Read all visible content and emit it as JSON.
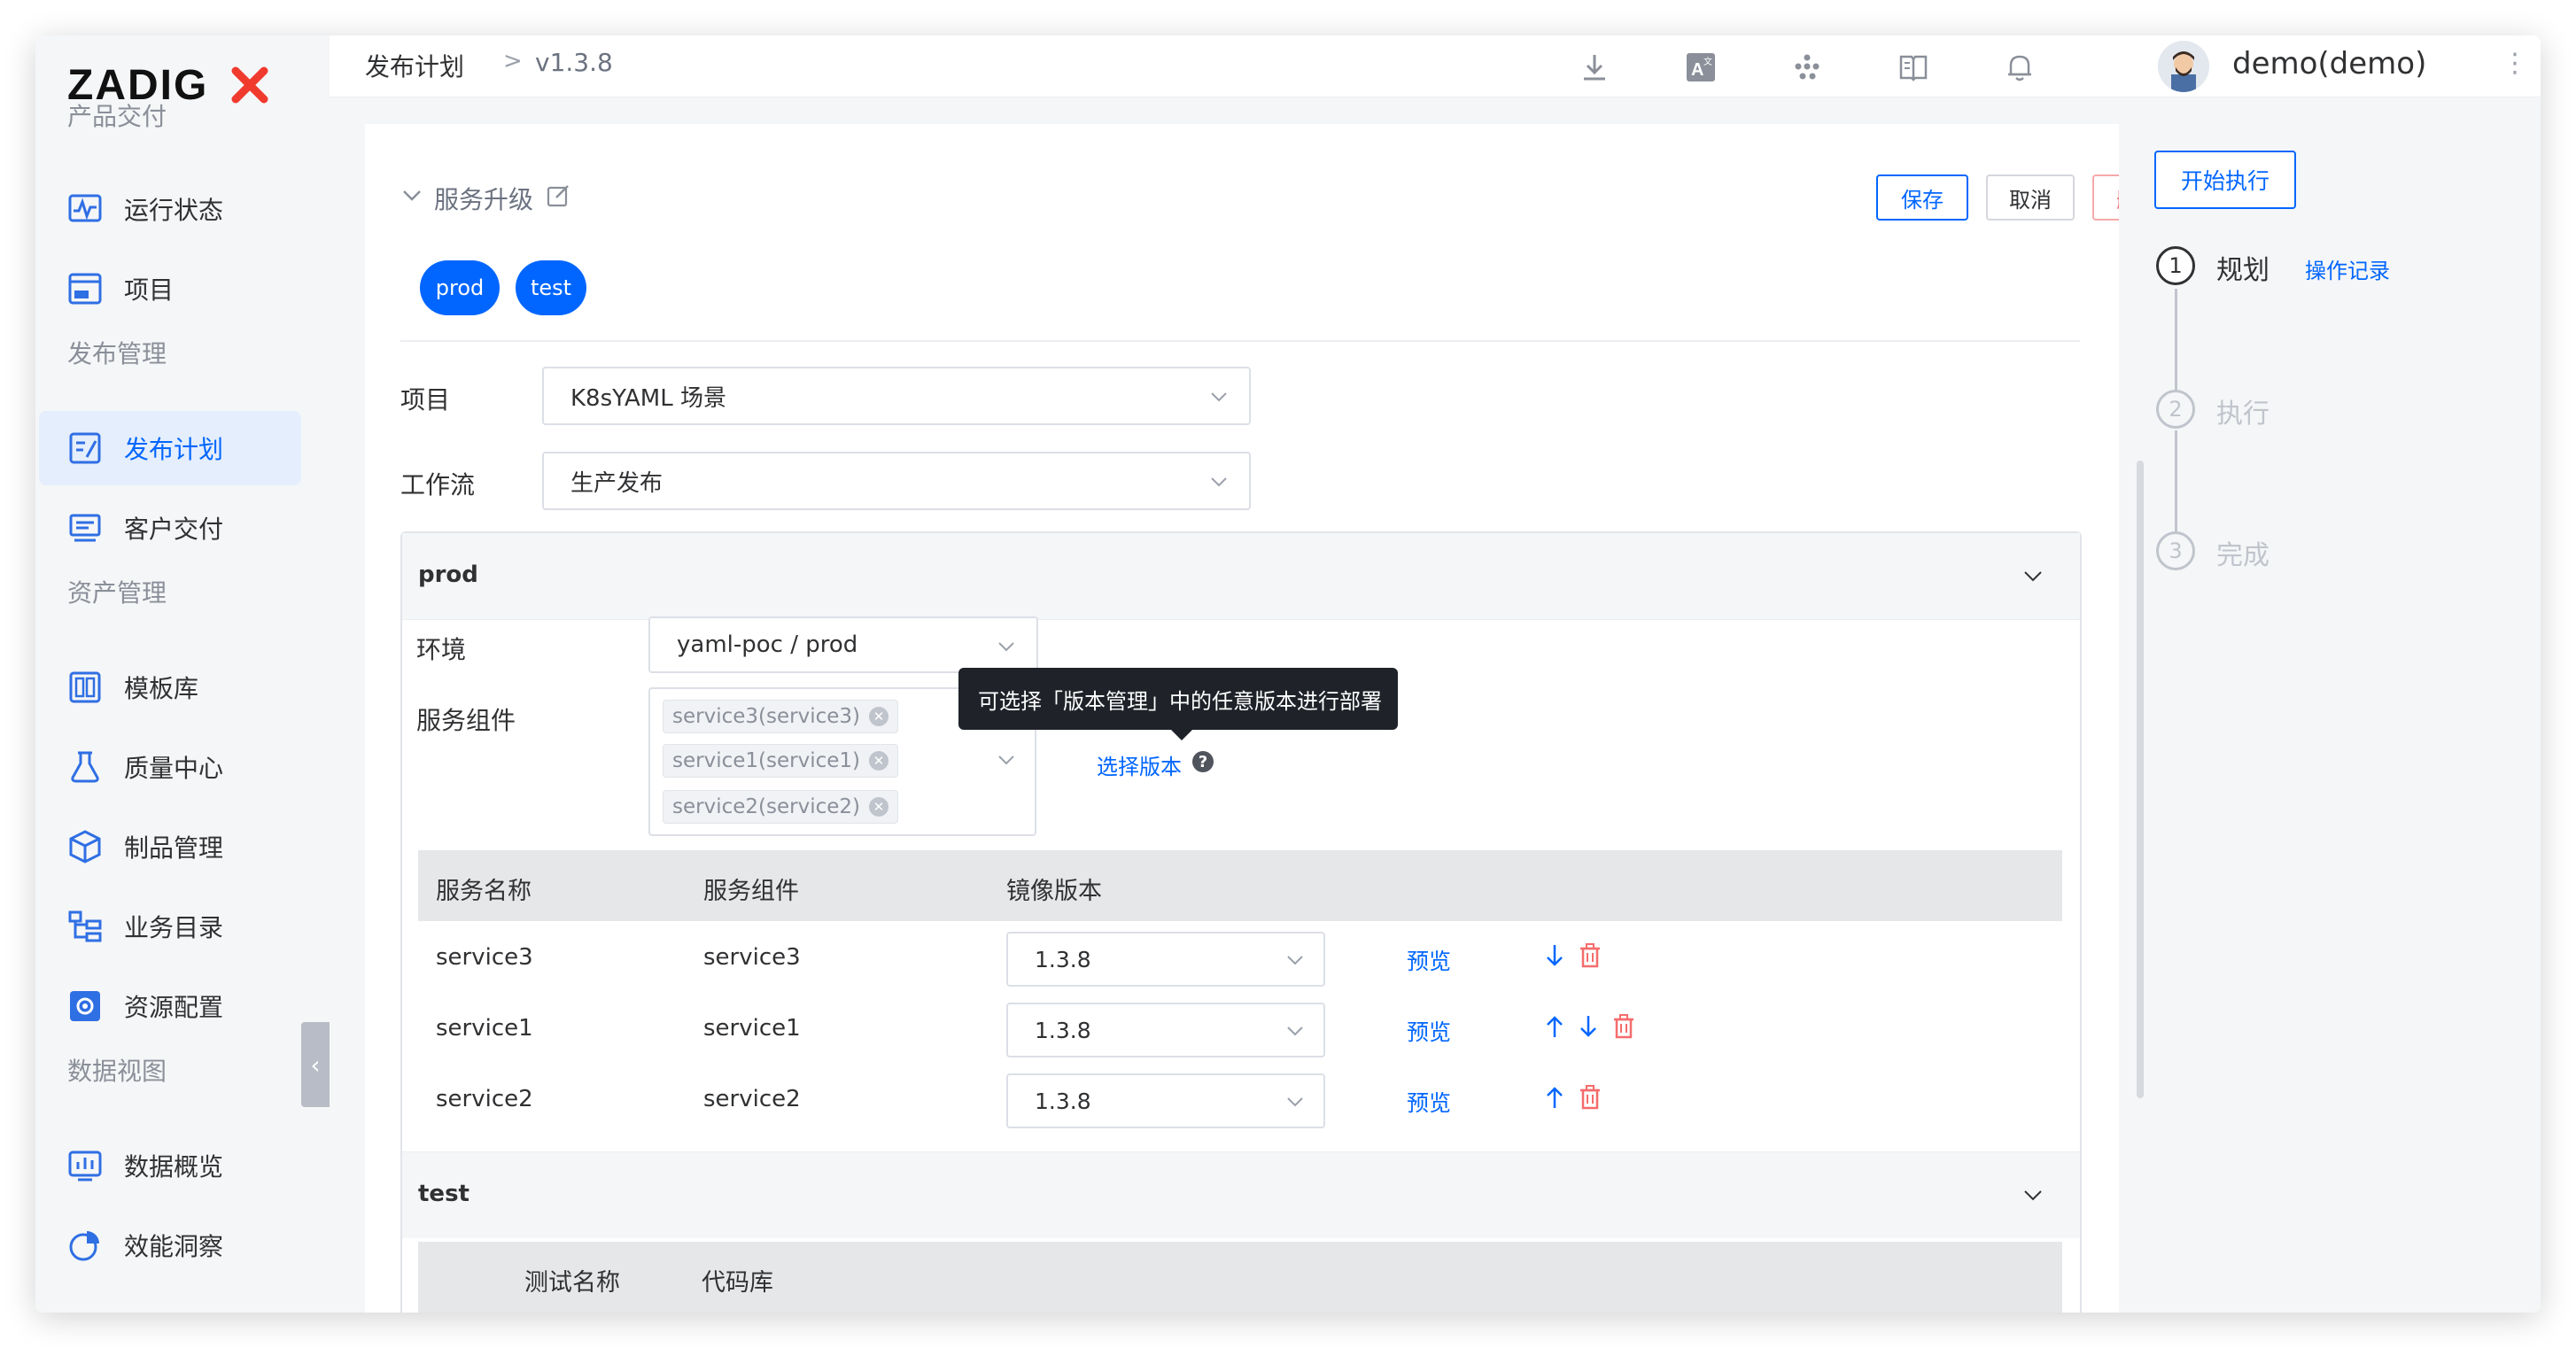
{
  "app": {
    "logo_text": "ZADIGX",
    "brand_color": "#0066ff"
  },
  "sidebar": {
    "groups": [
      {
        "label": "产品交付",
        "items": [
          {
            "label": "运行状态",
            "icon": "pulse-monitor-icon"
          },
          {
            "label": "项目",
            "icon": "pm-project-icon"
          }
        ]
      },
      {
        "label": "发布管理",
        "items": [
          {
            "label": "发布计划",
            "icon": "release-plan-icon",
            "active": true
          },
          {
            "label": "客户交付",
            "icon": "customer-delivery-icon"
          }
        ]
      },
      {
        "label": "资产管理",
        "items": [
          {
            "label": "模板库",
            "icon": "template-library-icon"
          },
          {
            "label": "质量中心",
            "icon": "flask-icon"
          },
          {
            "label": "制品管理",
            "icon": "package-icon"
          },
          {
            "label": "业务目录",
            "icon": "catalog-icon"
          },
          {
            "label": "资源配置",
            "icon": "gear-box-icon"
          }
        ]
      },
      {
        "label": "数据视图",
        "items": [
          {
            "label": "数据概览",
            "icon": "bar-chart-icon"
          },
          {
            "label": "效能洞察",
            "icon": "pie-chart-icon"
          }
        ]
      }
    ]
  },
  "topbar": {
    "breadcrumb_main": "发布计划",
    "breadcrumb_sep": ">",
    "breadcrumb_version": "v1.3.8",
    "user_name": "demo(demo)"
  },
  "section": {
    "title": "服务升级",
    "save_label": "保存",
    "cancel_label": "取消",
    "delete_label": "删除",
    "env_tags": [
      "prod",
      "test"
    ]
  },
  "form": {
    "project_label": "项目",
    "project_value": "K8sYAML 场景",
    "workflow_label": "工作流",
    "workflow_value": "生产发布"
  },
  "prod": {
    "title": "prod",
    "env_label": "环境",
    "env_value": "yaml-poc / prod",
    "component_label": "服务组件",
    "components": [
      "service3(service3)",
      "service1(service1)",
      "service2(service2)"
    ],
    "select_version_label": "选择版本",
    "help_glyph": "?",
    "tooltip": "可选择「版本管理」中的任意版本进行部署",
    "table": {
      "headers": [
        "服务名称",
        "服务组件",
        "镜像版本"
      ],
      "rows": [
        {
          "service": "service3",
          "component": "service3",
          "version": "1.3.8",
          "preview": "预览"
        },
        {
          "service": "service1",
          "component": "service1",
          "version": "1.3.8",
          "preview": "预览"
        },
        {
          "service": "service2",
          "component": "service2",
          "version": "1.3.8",
          "preview": "预览"
        }
      ]
    }
  },
  "test": {
    "title": "test",
    "headers": [
      "测试名称",
      "代码库"
    ]
  },
  "steps": {
    "start_label": "开始执行",
    "items": [
      {
        "number": "1",
        "label": "规划",
        "link": "操作记录"
      },
      {
        "number": "2",
        "label": "执行"
      },
      {
        "number": "3",
        "label": "完成"
      }
    ]
  }
}
